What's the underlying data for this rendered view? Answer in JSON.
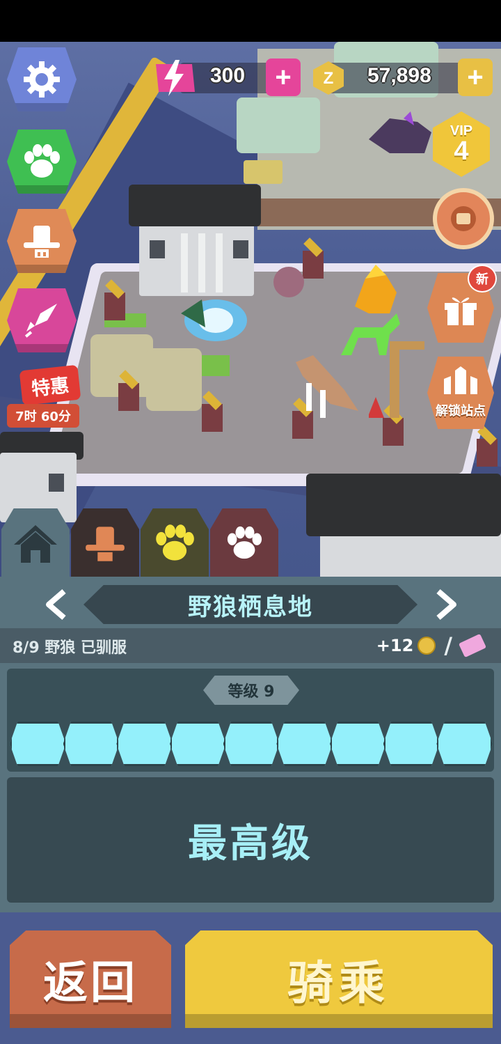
{
  "hud": {
    "energy": "300",
    "coins": "57,898",
    "vip_label": "VIP",
    "vip_level": "4",
    "sale_label": "特惠",
    "sale_timer": "7时 60分",
    "new_badge": "新",
    "unlock_label": "解锁站点"
  },
  "habitat": {
    "title": "野狼栖息地",
    "tamed_text": "8/9 野狼 已驯服",
    "reward": "+12",
    "level_label": "等级 9",
    "segments_filled": 9,
    "segments_total": 9,
    "max_label": "最高级"
  },
  "buttons": {
    "back": "返回",
    "ride": "骑乘"
  },
  "colors": {
    "energy_pink": "#e5459a",
    "coin_gold": "#e8c044",
    "progress_cyan": "#94f0fb",
    "panel_teal": "#59737e",
    "back_orange": "#c76b4a",
    "ride_yellow": "#efc93e"
  },
  "icons": [
    "gear-icon",
    "paw-icon",
    "cowboy-hat-icon",
    "rocket-icon",
    "lightning-icon",
    "zoo-coin-icon",
    "gift-icon",
    "gate-icon",
    "home-icon",
    "ticket-icon"
  ]
}
